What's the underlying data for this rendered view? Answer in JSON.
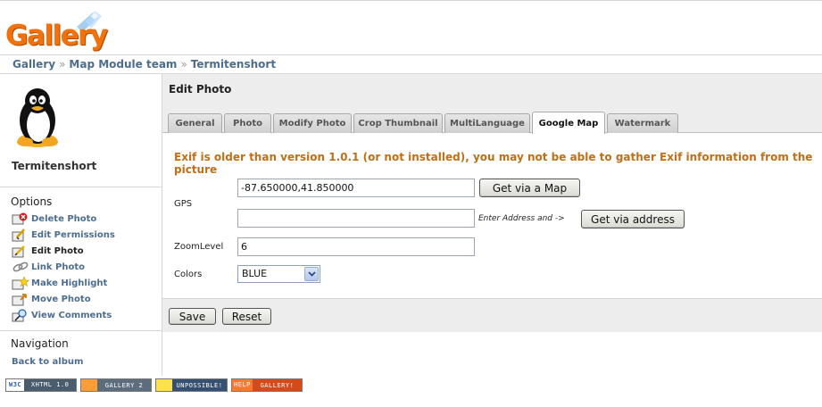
{
  "logo": {
    "text": "Gallery"
  },
  "breadcrumb": {
    "items": [
      "Gallery",
      "Map Module team",
      "Termitenshort"
    ],
    "separator": "»"
  },
  "sidebar": {
    "album_title": "Termitenshort",
    "options_title": "Options",
    "options": [
      {
        "label": "Delete Photo",
        "icon": "delete-icon"
      },
      {
        "label": "Edit Permissions",
        "icon": "permissions-icon"
      },
      {
        "label": "Edit Photo",
        "icon": "edit-icon",
        "current": true
      },
      {
        "label": "Link Photo",
        "icon": "link-icon"
      },
      {
        "label": "Make Highlight",
        "icon": "highlight-icon"
      },
      {
        "label": "Move Photo",
        "icon": "move-icon"
      },
      {
        "label": "View Comments",
        "icon": "comments-icon"
      }
    ],
    "navigation_title": "Navigation",
    "back_link": "Back to album"
  },
  "main": {
    "title": "Edit Photo",
    "tabs": [
      "General",
      "Photo",
      "Modify Photo",
      "Crop Thumbnail",
      "MultiLanguage",
      "Google Map",
      "Watermark"
    ],
    "active_tab": "Google Map",
    "warning": "Exif is older than version 1.0.1 (or not installed), you may not be able to gather Exif information from the picture",
    "gps_label": "GPS",
    "gps_value": "-87.650000,41.850000",
    "get_via_map": "Get via a Map",
    "address_value": "",
    "address_hint": "Enter Address and ->",
    "get_via_address": "Get via address",
    "zoom_label": "ZoomLevel",
    "zoom_value": "6",
    "colors_label": "Colors",
    "colors_value": "BLUE",
    "save_label": "Save",
    "reset_label": "Reset"
  },
  "badges": {
    "w3c": [
      "W3C",
      "XHTML 1.0"
    ],
    "gallery2": "GALLERY 2",
    "unpossible": "UNPOSSIBLE!",
    "help": [
      "HELP",
      "GALLERY!"
    ]
  },
  "colors": {
    "link": "#4d6d8f",
    "warning": "#bf6f15",
    "logo": "#f0720e"
  }
}
